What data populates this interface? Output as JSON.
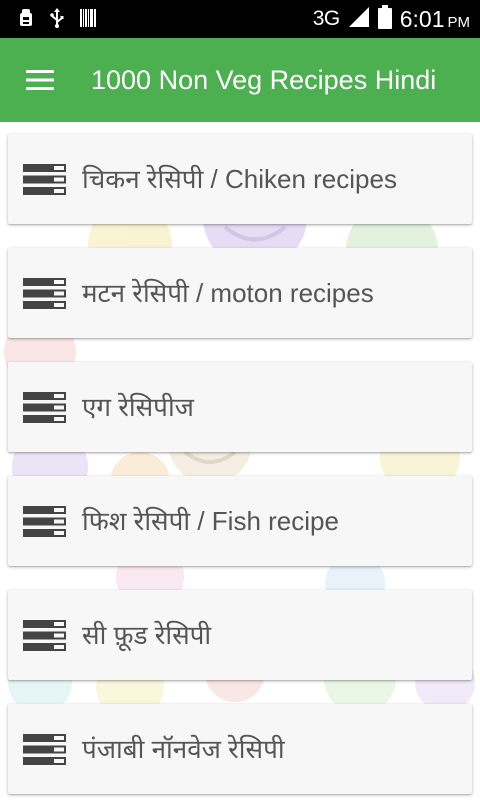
{
  "status_bar": {
    "network": "3G",
    "time": "6:01",
    "time_suffix": "PM",
    "icons": [
      "android-debug-icon",
      "usb-icon",
      "barcode-icon",
      "signal-icon",
      "battery-icon"
    ]
  },
  "app_bar": {
    "title": "1000 Non Veg Recipes Hindi",
    "menu_icon": "hamburger-menu-icon",
    "color": "#4caf50"
  },
  "categories": [
    {
      "label": "चिकन रेसिपी / Chiken recipes",
      "icon": "list-icon"
    },
    {
      "label": "मटन रेसिपी / moton recipes",
      "icon": "list-icon"
    },
    {
      "label": "एग रेसिपीज",
      "icon": "list-icon"
    },
    {
      "label": "फिश रेसिपी / Fish recipe",
      "icon": "list-icon"
    },
    {
      "label": "सी फ़ूड रेसिपी",
      "icon": "list-icon"
    },
    {
      "label": "पंजाबी नॉनवेज रेसिपी",
      "icon": "list-icon"
    }
  ]
}
